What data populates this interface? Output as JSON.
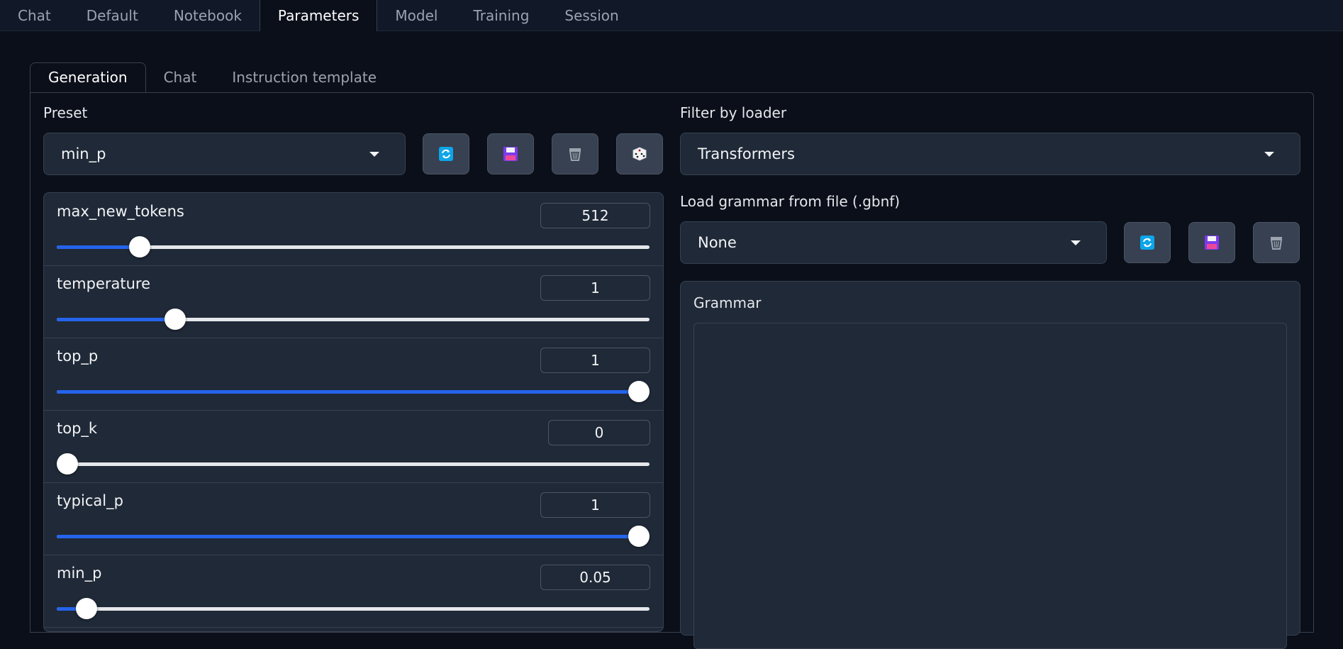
{
  "top_tabs": [
    "Chat",
    "Default",
    "Notebook",
    "Parameters",
    "Model",
    "Training",
    "Session"
  ],
  "active_top_tab": "Parameters",
  "sub_tabs": [
    "Generation",
    "Chat",
    "Instruction template"
  ],
  "active_sub_tab": "Generation",
  "preset": {
    "label": "Preset",
    "value": "min_p"
  },
  "preset_buttons": [
    "refresh-icon",
    "save-icon",
    "delete-icon",
    "random-icon"
  ],
  "filter": {
    "label": "Filter by loader",
    "value": "Transformers"
  },
  "grammar_file": {
    "label": "Load grammar from file (.gbnf)",
    "value": "None"
  },
  "grammar_buttons": [
    "refresh-icon",
    "save-icon",
    "delete-icon"
  ],
  "grammar": {
    "label": "Grammar",
    "value": ""
  },
  "sliders": [
    {
      "name": "max_new_tokens",
      "value": "512",
      "fraction": 0.14
    },
    {
      "name": "temperature",
      "value": "1",
      "fraction": 0.2
    },
    {
      "name": "top_p",
      "value": "1",
      "fraction": 1.0
    },
    {
      "name": "top_k",
      "value": "0",
      "fraction": 0.0
    },
    {
      "name": "typical_p",
      "value": "1",
      "fraction": 1.0
    },
    {
      "name": "min_p",
      "value": "0.05",
      "fraction": 0.05
    }
  ],
  "colors": {
    "accent": "#2563eb",
    "background": "#0b0f19",
    "panel": "#1f2937"
  }
}
